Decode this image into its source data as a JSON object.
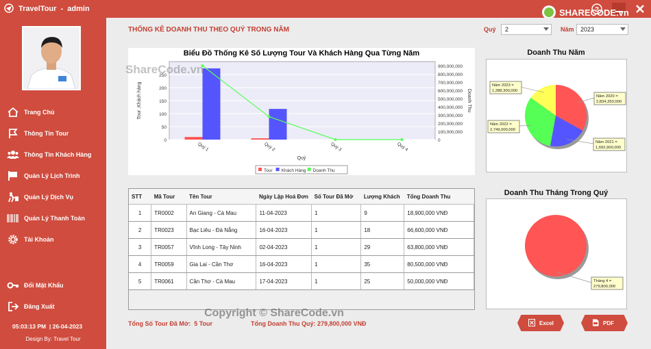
{
  "window": {
    "title": "TravelTour  -  admin"
  },
  "brand": {
    "logo_text": "SHARECODE.vn",
    "accent": "#cf4c3e",
    "title_red": "#c33e31"
  },
  "sidebar": {
    "items": [
      {
        "label": "Trang Chủ",
        "icon": "home-icon"
      },
      {
        "label": "Thông Tin Tour",
        "icon": "flag-icon"
      },
      {
        "label": "Thông Tin Khách Hàng",
        "icon": "users-icon"
      },
      {
        "label": "Quản Lý Lịch Trình",
        "icon": "schedule-flag-icon"
      },
      {
        "label": "Quản Lý Dịch Vụ",
        "icon": "service-icon"
      },
      {
        "label": "Quản Lý Thanh Toán",
        "icon": "barcode-icon"
      },
      {
        "label": "Tài Khoản",
        "icon": "gear-icon"
      }
    ],
    "change_password": "Đổi Mật Khẩu",
    "logout": "Đăng Xuất",
    "clock": "05:03:13 PM  | 26-04-2023",
    "designed_by": "Design By: Travel Tour"
  },
  "main": {
    "title": "THỐNG KÊ DOANH THU THEO QUÝ TRONG NĂM",
    "filters": {
      "quarter_label": "Quý",
      "quarter_value": "2",
      "year_label": "Năm",
      "year_value": "2023"
    }
  },
  "chart_data": [
    {
      "type": "bar+line",
      "title": "Biểu Đồ Thống Kê Số Lượng Tour Và Khách Hàng Qua Từng Năm",
      "categories": [
        "Quý 1",
        "Quý 2",
        "Quý 3",
        "Quý 4"
      ],
      "xlabel": "Quý",
      "ylabel": "Tour ,Khách hàng",
      "ylabel_right": "Doanh Thu",
      "ylim": [
        0,
        300
      ],
      "yticks": [
        "0",
        "50",
        "100",
        "150",
        "200",
        "250"
      ],
      "ylim_right": [
        0,
        950000000
      ],
      "yticks_right": [
        "0",
        "100,000,000",
        "200,000,000",
        "300,000,000",
        "400,000,000",
        "500,000,000",
        "600,000,000",
        "700,000,000",
        "800,000,000",
        "900,000,000"
      ],
      "series": [
        {
          "name": "Tour",
          "type": "bar",
          "axis": "left",
          "color": "#ff5555",
          "values": [
            10,
            5,
            0,
            0
          ]
        },
        {
          "name": "Khách Hàng",
          "type": "bar",
          "axis": "left",
          "color": "#5555ff",
          "values": [
            274,
            118,
            0,
            0
          ]
        },
        {
          "name": "Doanh Thu",
          "type": "line",
          "axis": "right",
          "color": "#55ff55",
          "values": [
            900000000,
            279800000,
            0,
            0
          ]
        }
      ],
      "legend": "bottom"
    },
    {
      "type": "pie",
      "title": "Doanh Thu Năm",
      "slices": [
        {
          "label": "Năm 2020 =",
          "value_text": "2,834,350,000",
          "value": 2834350000,
          "color": "#ff5555"
        },
        {
          "label": "Năm 2021 =",
          "value_text": "1,692,900,000",
          "value": 1692900000,
          "color": "#5555ff"
        },
        {
          "label": "Năm 2022 =",
          "value_text": "2,749,000,000",
          "value": 2749000000,
          "color": "#55ff55"
        },
        {
          "label": "Năm 2023 =",
          "value_text": "1,288,300,000",
          "value": 1288300000,
          "color": "#ffff55"
        }
      ]
    },
    {
      "type": "pie",
      "title": "Doanh Thu Tháng Trong Quý",
      "slices": [
        {
          "label": "Tháng 4 =",
          "value_text": "279,800,000",
          "value": 279800000,
          "color": "#ff5555"
        }
      ]
    }
  ],
  "table": {
    "headers": [
      "STT",
      "Mã Tour",
      "Tên Tour",
      "Ngày Lập Hoá Đơn",
      "Số Tour Đã Mở",
      "Lượng Khách",
      "Tổng Doanh Thu"
    ],
    "rows": [
      [
        "1",
        "TR0002",
        "An Giang - Cà Mau",
        "11-04-2023",
        "1",
        "9",
        "18,900,000 VNĐ"
      ],
      [
        "2",
        "TR0023",
        "Bạc Liêu - Đà Nẵng",
        "16-04-2023",
        "1",
        "18",
        "66,600,000 VNĐ"
      ],
      [
        "3",
        "TR0057",
        "Vĩnh Long - Tây Ninh",
        "02-04-2023",
        "1",
        "29",
        "63,800,000 VNĐ"
      ],
      [
        "4",
        "TR0059",
        "Gia Lai - Cần Thơ",
        "16-04-2023",
        "1",
        "35",
        "80,500,000 VNĐ"
      ],
      [
        "5",
        "TR0061",
        "Cần Thơ - Cà Mau",
        "17-04-2023",
        "1",
        "25",
        "50,000,000 VNĐ"
      ]
    ]
  },
  "summary": {
    "tour_count": "Tổng Số Tour Đã Mở:  5 Tour",
    "revenue": "Tổng Doanh Thu Quý: 279,800,000 VNĐ"
  },
  "buttons": {
    "excel": "Excel",
    "pdf": "PDF"
  },
  "watermarks": {
    "center": "ShareCode.vn",
    "bottom": "Copyright © ShareCode.vn"
  }
}
